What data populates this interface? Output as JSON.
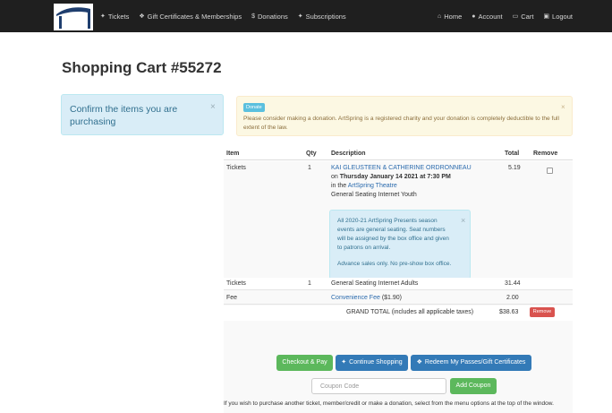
{
  "nav": {
    "left": [
      {
        "icon": "ticket-icon",
        "glyph": "✦",
        "label": "Tickets"
      },
      {
        "icon": "gift-icon",
        "glyph": "❖",
        "label": "Gift Certificates & Memberships"
      },
      {
        "icon": "dollar-icon",
        "glyph": "$",
        "label": "Donations"
      },
      {
        "icon": "ticket-icon",
        "glyph": "✦",
        "label": "Subscriptions"
      }
    ],
    "right": [
      {
        "icon": "home-icon",
        "glyph": "⌂",
        "label": "Home"
      },
      {
        "icon": "user-icon",
        "glyph": "●",
        "label": "Account"
      },
      {
        "icon": "cart-icon",
        "glyph": "▭",
        "label": "Cart"
      },
      {
        "icon": "lock-icon",
        "glyph": "▣",
        "label": "Logout"
      }
    ]
  },
  "title": "Shopping Cart #55272",
  "left_alert": "Confirm the items you are purchasing",
  "donation": {
    "badge": "Donate",
    "text": "Please consider making a donation. ArtSpring is a registered charity and your donation is completely deductible to the full extent of the law."
  },
  "table": {
    "headers": {
      "item": "Item",
      "qty": "Qty",
      "description": "Description",
      "total": "Total",
      "remove": "Remove"
    },
    "row1": {
      "item": "Tickets",
      "qty": "1",
      "event": "KAI GLEUSTEEN & CATHERINE ORDRONNEAU",
      "on": "on",
      "date": "Thursday January 14 2021 at 7:30 PM",
      "in": "in the",
      "venue": "ArtSpring Theatre",
      "seating": "General Seating Internet Youth",
      "total": "5.19",
      "notice": [
        "All 2020-21 ArtSpring Presents season",
        "events are general seating. Seat numbers",
        "will be assigned by the box office and given",
        "to patrons on arrival.",
        "",
        "Advance sales only. No pre-show box office."
      ]
    },
    "row2": {
      "item": "Tickets",
      "qty": "1",
      "description": "General Seating Internet Adults",
      "total": "31.44"
    },
    "row3": {
      "item": "Fee",
      "fee_link": "Convenience Fee",
      "fee_amount": "($1.90)",
      "total": "2.00"
    },
    "grand": {
      "label": "GRAND TOTAL (includes all applicable taxes)",
      "total": "$38.63",
      "remove": "Remove"
    }
  },
  "buttons": {
    "checkout": "Checkout & Pay",
    "continue": "Continue Shopping",
    "redeem": "Redeem My Passes/Gift Certificates",
    "add_coupon": "Add Coupon"
  },
  "coupon_placeholder": "Coupon Code",
  "footer": "If you wish to purchase another ticket, member/credit or make a donation, select from the menu options at the top of the window."
}
